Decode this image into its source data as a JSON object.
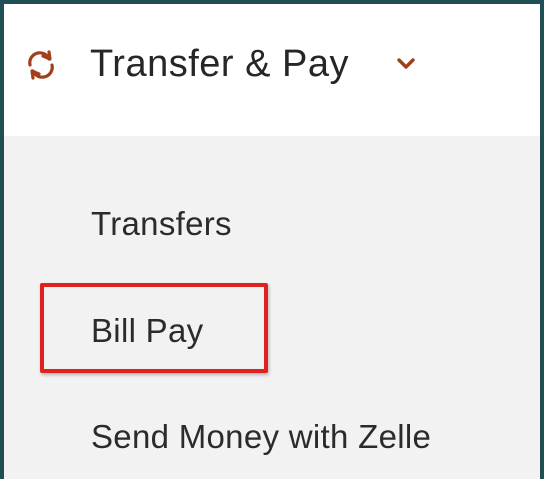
{
  "menu": {
    "section_label": "Transfer & Pay",
    "section_icon": "transfer-cycle-icon",
    "expand_icon": "chevron-down-icon",
    "accent_color": "#a0401a",
    "border_color": "#1f4f55",
    "items": [
      {
        "label": "Transfers"
      },
      {
        "label": "Bill Pay",
        "highlighted": true
      },
      {
        "label": "Send Money with Zelle"
      }
    ]
  },
  "highlight": {
    "color": "#e0211d"
  }
}
